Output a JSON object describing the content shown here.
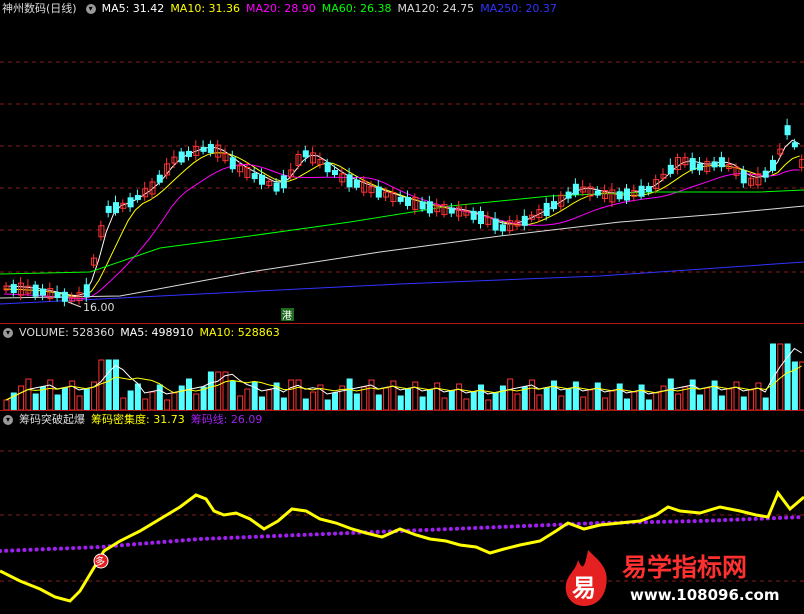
{
  "price_panel": {
    "title": "神州数码(日线)",
    "ma": [
      {
        "label": "MA5: 31.42",
        "color": "#ffffff"
      },
      {
        "label": "MA10: 31.36",
        "color": "#ffff00"
      },
      {
        "label": "MA20: 28.90",
        "color": "#ff00ff"
      },
      {
        "label": "MA60: 26.38",
        "color": "#00ff00"
      },
      {
        "label": "MA120: 24.75",
        "color": "#dcdcdc"
      },
      {
        "label": "MA250: 20.37",
        "color": "#3333ff"
      }
    ],
    "low_label": "16.00",
    "badge": "港"
  },
  "volume_panel": {
    "title": "VOLUME: 528360",
    "ma5": "MA5: 498910",
    "ma10": "MA10: 528863"
  },
  "indicator_panel": {
    "title": "筹码突破起爆",
    "line1": "筹码密集度: 31.73",
    "line2": "筹码线: 26.09",
    "marker": "多"
  },
  "watermark": {
    "logo_char": "易",
    "name": "易学指标网",
    "url": "www.108096.com"
  },
  "colors": {
    "up": "#ff3333",
    "down": "#54ffff",
    "grid": "#8a1c1c",
    "indicator": "#ffff00",
    "chip_line": "#a020f0",
    "ma5": "#ffffff",
    "ma10": "#ffff00",
    "ma20": "#ff00ff",
    "ma60": "#00ff00",
    "ma120": "#dcdcdc",
    "ma250": "#3333ff"
  }
}
